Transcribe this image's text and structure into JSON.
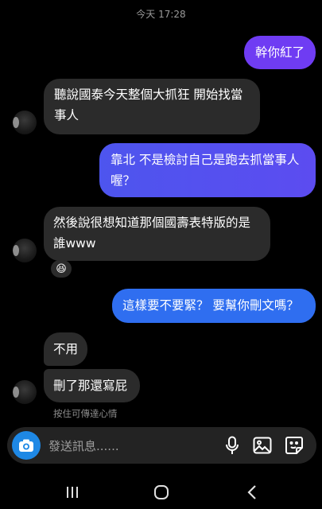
{
  "status": {
    "time": "今天 17:28"
  },
  "messages": [
    {
      "id": "m1",
      "direction": "outgoing",
      "text": "幹你紅了"
    },
    {
      "id": "m2",
      "direction": "incoming",
      "text": "聽說國泰今天整個大抓狂 開始找當事人"
    },
    {
      "id": "m3",
      "direction": "outgoing",
      "text": "靠北 不是檢討自己是跑去抓當事人喔？"
    },
    {
      "id": "m4",
      "direction": "incoming",
      "text": "然後說很想知道那個國壽表特版的是誰www",
      "reaction": "😆"
    },
    {
      "id": "m5",
      "direction": "outgoing",
      "text": "這樣要不要緊？ 要幫你刪文嗎？"
    },
    {
      "id": "m6",
      "direction": "incoming",
      "text": "不用"
    },
    {
      "id": "m7",
      "direction": "incoming",
      "text": "刪了那還寫屁"
    }
  ],
  "hint": "按住可傳達心情",
  "composer": {
    "placeholder": "發送訊息......",
    "icons": [
      "camera-icon",
      "microphone-icon",
      "gallery-icon",
      "sticker-icon"
    ]
  },
  "navbar": {
    "icons": [
      "recents-icon",
      "home-icon",
      "back-icon"
    ]
  },
  "colors": {
    "incoming_bubble": "#2b2b2b",
    "outgoing_purple": "#6a3ff0",
    "outgoing_blue": "#2d6cf0"
  }
}
